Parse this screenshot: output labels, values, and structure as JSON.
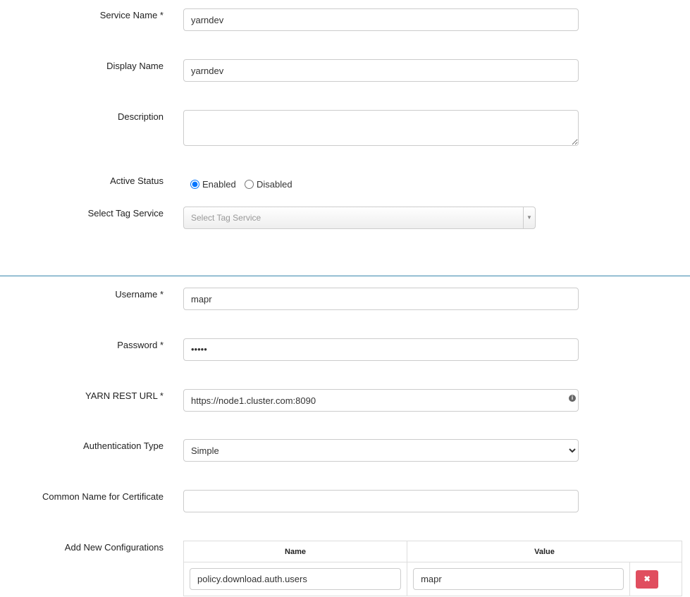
{
  "service": {
    "service_name": {
      "label": "Service Name *",
      "value": "yarndev"
    },
    "display_name": {
      "label": "Display Name",
      "value": "yarndev"
    },
    "description": {
      "label": "Description",
      "value": ""
    },
    "active_status": {
      "label": "Active Status",
      "options": [
        "Enabled",
        "Disabled"
      ],
      "selected": "Enabled"
    },
    "tag_service": {
      "label": "Select Tag Service",
      "placeholder": "Select Tag Service"
    }
  },
  "config": {
    "username": {
      "label": "Username *",
      "value": "mapr"
    },
    "password": {
      "label": "Password *",
      "value": "•••••"
    },
    "yarn_rest_url": {
      "label": "YARN REST URL *",
      "value": "https://node1.cluster.com:8090",
      "icon": "info-icon"
    },
    "auth_type": {
      "label": "Authentication Type",
      "value": "Simple"
    },
    "common_name": {
      "label": "Common Name for Certificate",
      "value": ""
    },
    "new_configs": {
      "label": "Add New Configurations",
      "headers": [
        "Name",
        "Value"
      ],
      "rows": [
        {
          "name": "policy.download.auth.users",
          "value": "mapr"
        }
      ],
      "delete_icon": "✖"
    }
  },
  "colors": {
    "divider": "#3a87ad",
    "delete": "#e04e5f",
    "radio": "#0075ff"
  }
}
